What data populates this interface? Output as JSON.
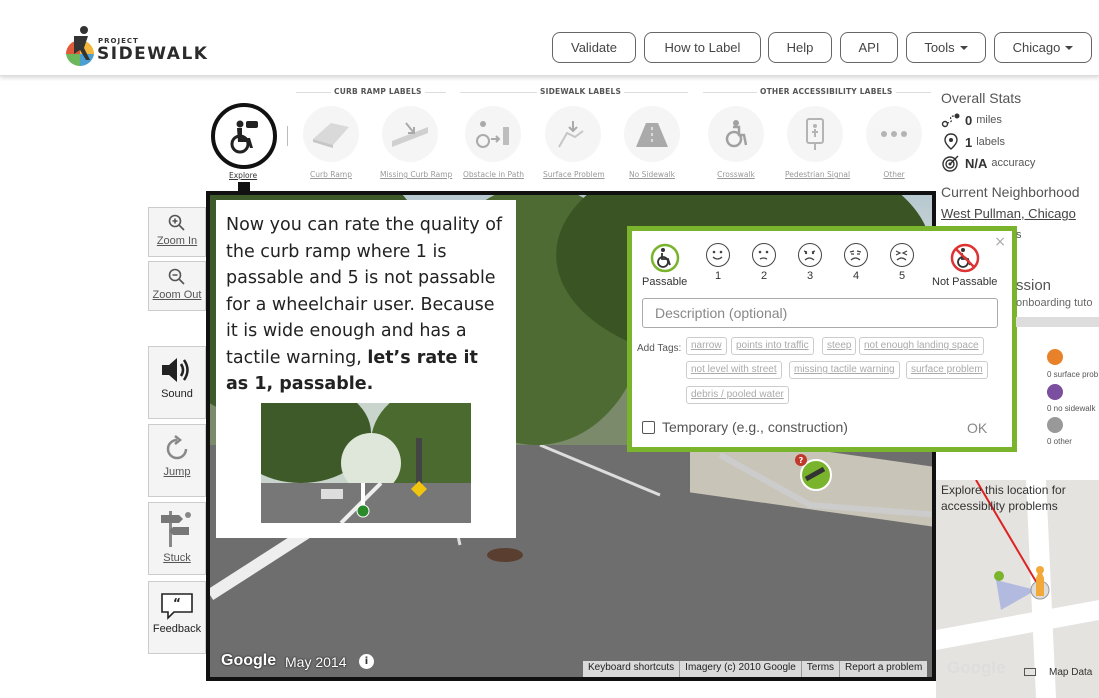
{
  "header": {
    "logo_small": "PROJECT",
    "logo_big": "SIDEWALK",
    "nav": {
      "validate": "Validate",
      "how_to_label": "How to Label",
      "help": "Help",
      "api": "API",
      "tools": "Tools",
      "city": "Chicago"
    }
  },
  "toolbar": {
    "groups": {
      "curb": "CURB RAMP LABELS",
      "sidewalk": "SIDEWALK LABELS",
      "other": "OTHER ACCESSIBILITY LABELS"
    },
    "explore": "Explore",
    "tools": [
      "Curb Ramp",
      "Missing Curb Ramp",
      "Obstacle in Path",
      "Surface Problem",
      "No Sidewalk",
      "Crosswalk",
      "Pedestrian Signal",
      "Other"
    ]
  },
  "controls": {
    "zoom_in": "Zoom In",
    "zoom_out": "Zoom Out",
    "sound": "Sound",
    "jump": "Jump",
    "stuck": "Stuck",
    "feedback": "Feedback"
  },
  "tutorial": {
    "text_plain": "Now you can rate the quality of the curb ramp where 1 is passable and 5 is not passable for a wheelchair user. Because it is wide enough and has a tactile warning, ",
    "text_bold": "let’s rate it as 1, passable."
  },
  "rating": {
    "close": "×",
    "passable": "Passable",
    "scores": [
      "1",
      "2",
      "3",
      "4",
      "5"
    ],
    "not_passable": "Not Passable",
    "description_placeholder": "Description (optional)",
    "add_tags": "Add Tags:",
    "tags": [
      "narrow",
      "points into traffic",
      "steep",
      "not enough landing space",
      "not level with street",
      "missing tactile warning",
      "surface problem",
      "debris / pooled water"
    ],
    "temporary": "Temporary (e.g., construction)",
    "ok": "OK",
    "accent_color": "#7ab42c"
  },
  "streetview": {
    "brand": "Google",
    "date": "May 2014",
    "info": "i",
    "footer": [
      "Keyboard shortcuts",
      "Imagery (c) 2010 Google",
      "Terms",
      "Report a problem"
    ]
  },
  "stats": {
    "overall_title": "Overall Stats",
    "miles_value": "0",
    "miles_unit": "miles",
    "labels_value": "1",
    "labels_unit": "labels",
    "accuracy_value": "N/A",
    "accuracy_unit": "accuracy",
    "neighborhood_title": "Current Neighborhood",
    "neighborhood_link": "West Pullman, Chicago",
    "neighborhood_tail": "s",
    "mission_fragment": "ssion",
    "mission_sub": "onboarding tuto",
    "counts": [
      "0 surface prob",
      "0 no sidewalk",
      "0 other"
    ],
    "map_caption": "Explore this location for accessibility problems",
    "map_google": "Google",
    "map_data": "Map Data"
  }
}
